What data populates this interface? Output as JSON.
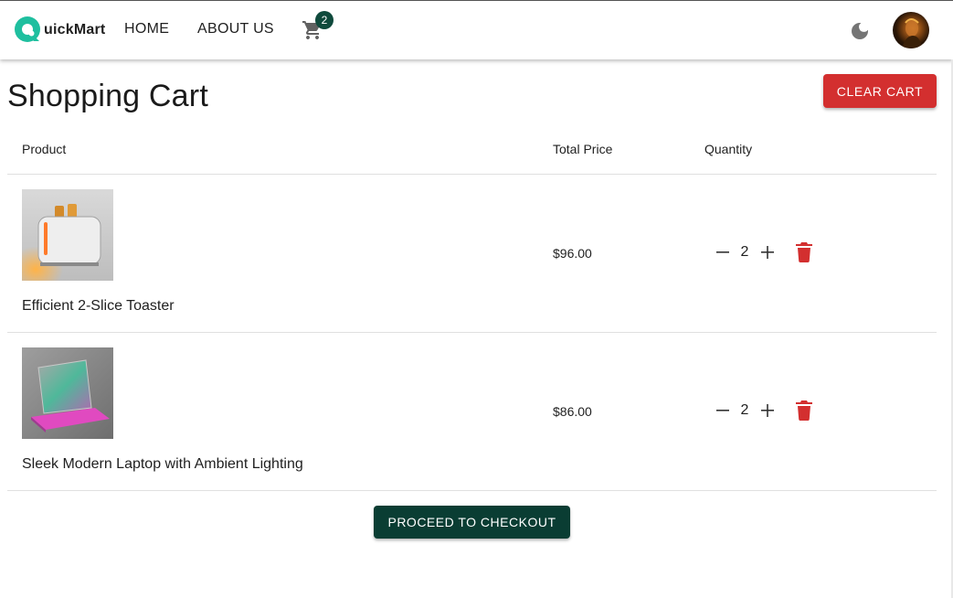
{
  "brand": {
    "name": "uickMart",
    "accent": "#1fbf9f"
  },
  "nav": {
    "home": "HOME",
    "about": "ABOUT US",
    "cart_count": "2"
  },
  "icons": {
    "cart": "cart-icon",
    "theme": "moon-icon",
    "avatar": "user-avatar",
    "delete": "trash-icon",
    "minus": "minus-icon",
    "plus": "plus-icon"
  },
  "page": {
    "title": "Shopping Cart",
    "clear_label": "CLEAR CART",
    "checkout_label": "PROCEED TO CHECKOUT"
  },
  "table": {
    "headers": {
      "product": "Product",
      "total_price": "Total Price",
      "quantity": "Quantity"
    },
    "rows": [
      {
        "name": "Efficient 2-Slice Toaster",
        "price": "$96.00",
        "qty": "2"
      },
      {
        "name": "Sleek Modern Laptop with Ambient Lighting",
        "price": "$86.00",
        "qty": "2"
      }
    ]
  },
  "colors": {
    "danger": "#d32f2f",
    "primary_dark": "#0a3d33",
    "badge": "#0f4a3c"
  }
}
